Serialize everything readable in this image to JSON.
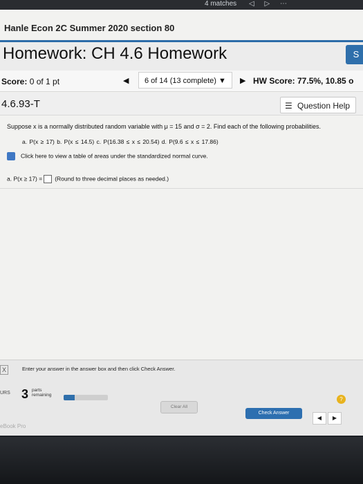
{
  "topbar": {
    "text": "4 matches",
    "icons": "◁ ▷ ⋯"
  },
  "course": {
    "title": "Hanle Econ 2C Summer 2020 section 80"
  },
  "homework": {
    "title": "Homework: CH 4.6 Homework",
    "side_button": "S"
  },
  "scorebar": {
    "score_label": "Score:",
    "score_value": "0 of 1 pt",
    "prev_glyph": "◀",
    "question_counter": "6 of 14 (13 complete) ▼",
    "next_glyph": "▶",
    "hw_score": "HW Score: 77.5%, 10.85 o"
  },
  "question": {
    "id": "4.6.93-T",
    "help_label": "Question Help",
    "help_icon": "list-icon",
    "prompt": "Suppose x is a normally distributed random variable with μ = 15 and σ = 2. Find each of the following probabilities.",
    "parts": "a. P(x ≥ 17)   b. P(x ≤ 14.5)   c. P(16.38 ≤ x ≤ 20.54)   d. P(9.6 ≤ x ≤ 17.86)",
    "table_link": "Click here to view a table of areas under the standardized normal curve.",
    "answer_prefix": "a. P(x ≥ 17) =",
    "answer_hint": "(Round to three decimal places as needed.)"
  },
  "footer": {
    "instruction": "Enter your answer in the answer box and then click Check Answer.",
    "parts_number": "3",
    "parts_label_1": "parts",
    "parts_label_2": "remaining",
    "progress_fraction": 0.25,
    "clear_label": "Clear All",
    "check_label": "Check Answer",
    "help_glyph": "?",
    "left_label": "URS",
    "ebook": "eBook Pro",
    "x_glyph": "X"
  },
  "colors": {
    "accent": "#2f6fab",
    "help": "#e8b31e"
  }
}
